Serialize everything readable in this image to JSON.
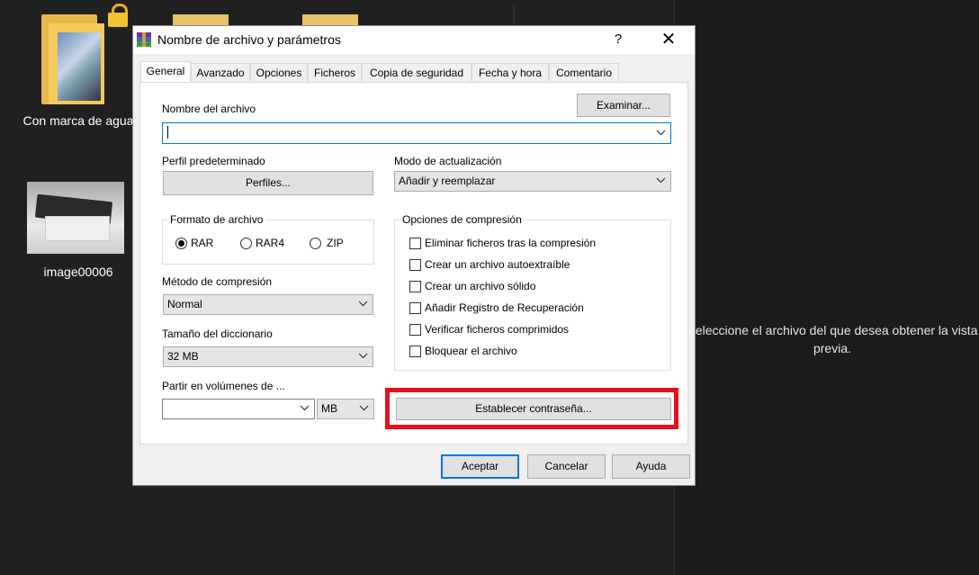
{
  "desktop": {
    "icons": [
      {
        "label": "Con marca de agua"
      },
      {
        "label": "image00006"
      }
    ],
    "preview_message": "Seleccione el archivo del que desea obtener la vista previa."
  },
  "dialog": {
    "title": "Nombre de archivo y parámetros",
    "help": "?",
    "close": "✕",
    "tabs": [
      "General",
      "Avanzado",
      "Opciones",
      "Ficheros",
      "Copia de seguridad",
      "Fecha y hora",
      "Comentario"
    ],
    "active_tab": "General",
    "filename_label": "Nombre del archivo",
    "filename_value": "",
    "browse_button": "Examinar...",
    "profile_label": "Perfil predeterminado",
    "profiles_button": "Perfiles...",
    "update_mode_label": "Modo de actualización",
    "update_mode_value": "Añadir y reemplazar",
    "format_group": "Formato de archivo",
    "formats": [
      {
        "label": "RAR",
        "checked": true
      },
      {
        "label": "RAR4",
        "checked": false
      },
      {
        "label": "ZIP",
        "checked": false
      }
    ],
    "compression_method_label": "Método de compresión",
    "compression_method_value": "Normal",
    "dictionary_label": "Tamaño del diccionario",
    "dictionary_value": "32 MB",
    "volumes_label": "Partir en volúmenes de ...",
    "volumes_value": "",
    "volumes_unit": "MB",
    "options_group": "Opciones de compresión",
    "options": [
      {
        "label": "Eliminar ficheros tras la compresión",
        "checked": false
      },
      {
        "label": "Crear un archivo autoextraíble",
        "checked": false
      },
      {
        "label": "Crear un archivo sólido",
        "checked": false
      },
      {
        "label": "Añadir Registro de Recuperación",
        "checked": false
      },
      {
        "label": "Verificar ficheros comprimidos",
        "checked": false
      },
      {
        "label": "Bloquear el archivo",
        "checked": false
      }
    ],
    "password_button": "Establecer contraseña...",
    "ok_button": "Aceptar",
    "cancel_button": "Cancelar",
    "help_button": "Ayuda"
  },
  "colors": {
    "highlight": "#e5121d",
    "focus": "#0078d7",
    "desktop_bg": "#202020"
  }
}
